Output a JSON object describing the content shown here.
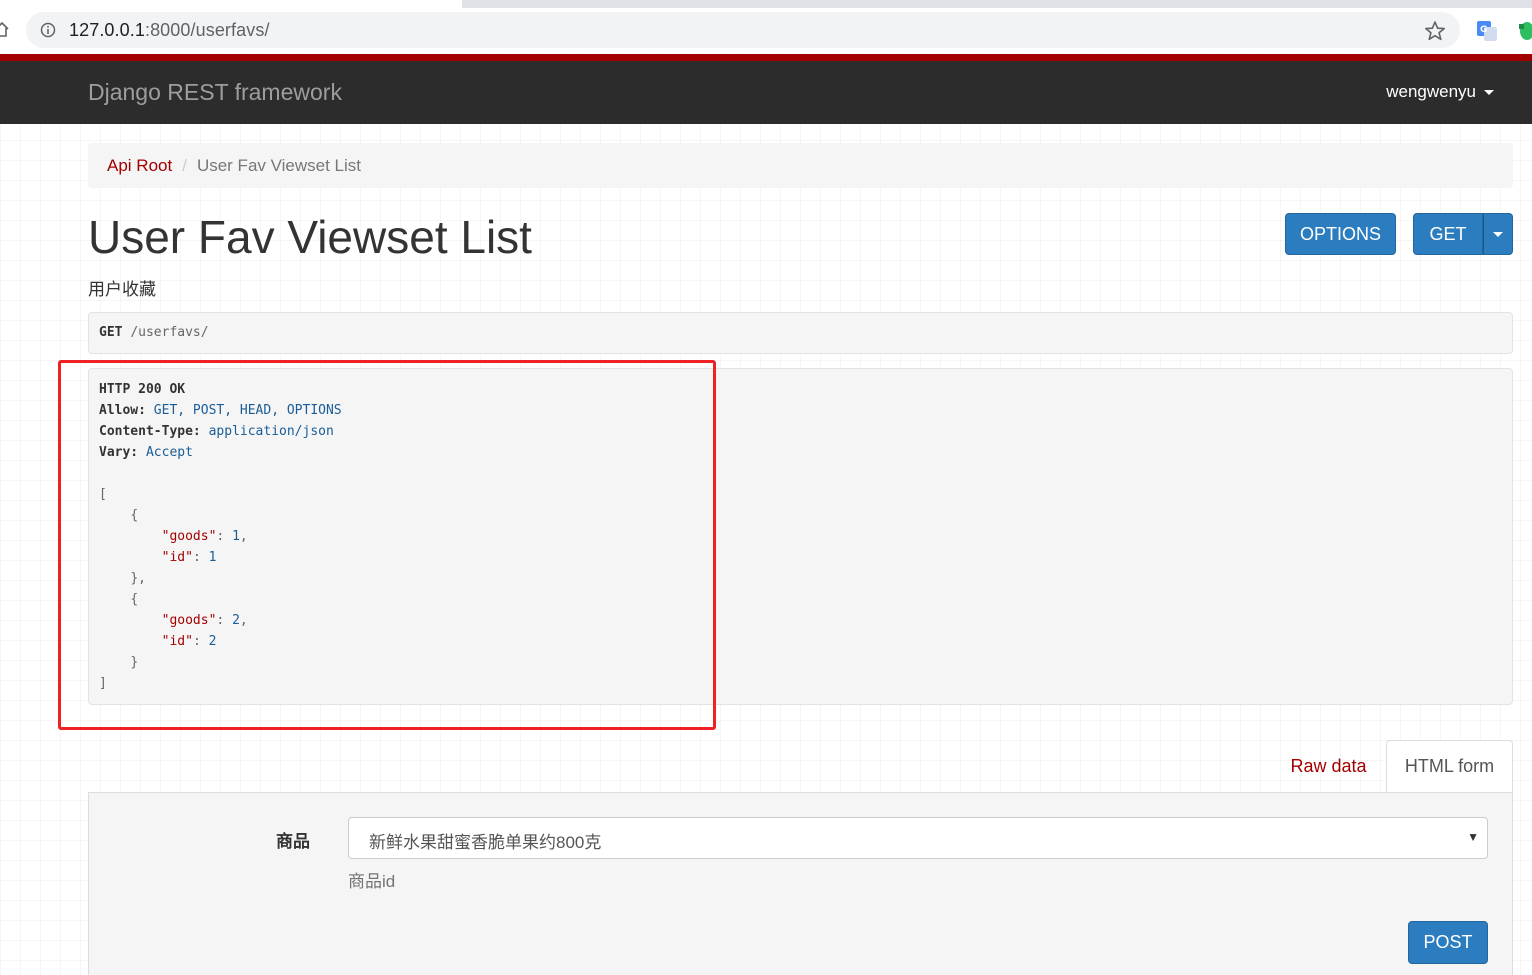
{
  "browser": {
    "url_host": "127.0.0.1",
    "url_rest": ":8000/userfavs/"
  },
  "navbar": {
    "brand": "Django REST framework",
    "username": "wengwenyu"
  },
  "breadcrumb": {
    "root": "Api Root",
    "separator": "/",
    "current": "User Fav Viewset List"
  },
  "page": {
    "title": "User Fav Viewset List",
    "description": "用户收藏",
    "options_label": "OPTIONS",
    "get_label": "GET"
  },
  "request": {
    "method": "GET",
    "path": "/userfavs/"
  },
  "response": {
    "status": "HTTP 200 OK",
    "headers": [
      {
        "name": "Allow:",
        "value": "GET, POST, HEAD, OPTIONS"
      },
      {
        "name": "Content-Type:",
        "value": "application/json"
      },
      {
        "name": "Vary:",
        "value": "Accept"
      }
    ],
    "items": [
      {
        "goods": "1",
        "id": "1"
      },
      {
        "goods": "2",
        "id": "2"
      }
    ],
    "keys": {
      "goods": "\"goods\"",
      "id": "\"id\""
    }
  },
  "form": {
    "tab_raw": "Raw data",
    "tab_html": "HTML form",
    "field_label": "商品",
    "selected_option": "新鲜水果甜蜜香脆单果约800克",
    "help_text": "商品id",
    "submit_label": "POST"
  },
  "colors": {
    "brand_red": "#a30000",
    "navbar_bg": "#2c2c2c",
    "button_blue": "#2c7dbf",
    "annotation_red": "#ee2222"
  }
}
